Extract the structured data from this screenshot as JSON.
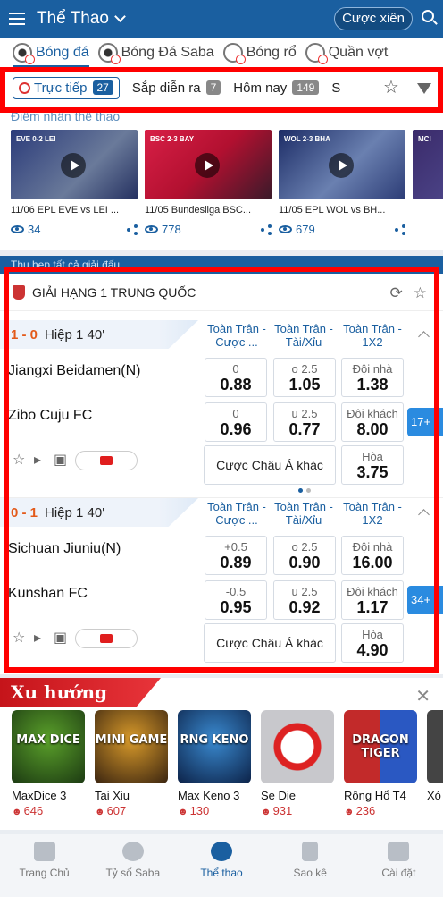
{
  "header": {
    "title": "Thể Thao",
    "parlay": "Cược xiên"
  },
  "sports_tabs": [
    {
      "label": "Bóng đá"
    },
    {
      "label": "Bóng Đá Saba"
    },
    {
      "label": "Bóng rổ"
    },
    {
      "label": "Quần vợt"
    }
  ],
  "filters": [
    {
      "label": "Trực tiếp",
      "count": "27"
    },
    {
      "label": "Sắp diễn ra",
      "count": "7"
    },
    {
      "label": "Hôm nay",
      "count": "149"
    },
    {
      "label": "S",
      "count": ""
    }
  ],
  "highlights": {
    "title": "Điểm nhấn thể thao",
    "cards": [
      {
        "score": "EVE 0-2 LEI",
        "caption": "11/06 EPL EVE vs LEI ...",
        "views": "34",
        "color": "#3a4a8a"
      },
      {
        "score": "BSC 2-3 BAY",
        "caption": "11/05 Bundesliga BSC...",
        "views": "778",
        "color": "#b3203a"
      },
      {
        "score": "WOL 2-3 BHA",
        "caption": "11/05 EPL WOL vs BH...",
        "views": "679",
        "color": "#2b3f7a"
      },
      {
        "score": "MCI",
        "caption": "",
        "views": "",
        "color": "#4a3a7a"
      }
    ]
  },
  "collapsed": {
    "label": "Thu hẹp tất cả giải đấu"
  },
  "league": {
    "name": "GIẢI HẠNG 1 TRUNG QUỐC",
    "columns": [
      "Toàn Trận - Cược ...",
      "Toàn Trận - Tài/Xỉu",
      "Toàn Trận - 1X2"
    ],
    "matches": [
      {
        "score": "1 - 0",
        "time": "Hiệp 1 40'",
        "home": "Jiangxi Beidamen(N)",
        "away": "Zibo Cuju FC",
        "hdp_home_line": "0",
        "hdp_home": "0.88",
        "hdp_away_line": "0",
        "hdp_away": "0.96",
        "ou_over_line": "o 2.5",
        "ou_over": "1.05",
        "ou_under_line": "u 2.5",
        "ou_under": "0.77",
        "x_home_label": "Đội nhà",
        "x_home": "1.38",
        "x_away_label": "Đội khách",
        "x_away": "8.00",
        "x_draw_label": "Hòa",
        "x_draw": "3.75",
        "more": "17+",
        "other": "Cược Châu Á khác"
      },
      {
        "score": "0 - 1",
        "time": "Hiệp 1 40'",
        "home": "Sichuan Jiuniu(N)",
        "away": "Kunshan FC",
        "hdp_home_line": "+0.5",
        "hdp_home": "0.89",
        "hdp_away_line": "-0.5",
        "hdp_away": "0.95",
        "ou_over_line": "o 2.5",
        "ou_over": "0.90",
        "ou_under_line": "u 2.5",
        "ou_under": "0.92",
        "x_home_label": "Đội nhà",
        "x_home": "16.00",
        "x_away_label": "Đội khách",
        "x_away": "1.17",
        "x_draw_label": "Hòa",
        "x_draw": "4.90",
        "more": "34+",
        "other": "Cược Châu Á khác"
      }
    ]
  },
  "trending": {
    "title": "Xu hướng",
    "games": [
      {
        "name": "MaxDice 3",
        "count": "646",
        "art": "MAX DICE",
        "color": "#2e5a1e"
      },
      {
        "name": "Tai Xiu",
        "count": "607",
        "art": "MINI GAME",
        "color": "#3b2a12"
      },
      {
        "name": "Max Keno 3",
        "count": "130",
        "art": "RNG KENO",
        "color": "#123a6a"
      },
      {
        "name": "Se Die",
        "count": "931",
        "art": "",
        "color": "#b7b7bb"
      },
      {
        "name": "Rồng Hổ T4",
        "count": "236",
        "art": "DRAGON TIGER",
        "color": "#1d2f5a"
      },
      {
        "name": "Xó",
        "count": "",
        "art": "",
        "color": "#444"
      }
    ]
  },
  "bottom_nav": [
    {
      "label": "Trang Chủ"
    },
    {
      "label": "Tỷ số Saba"
    },
    {
      "label": "Thể thao"
    },
    {
      "label": "Sao kê"
    },
    {
      "label": "Cài đặt"
    }
  ],
  "accent": "#1a5fa0"
}
